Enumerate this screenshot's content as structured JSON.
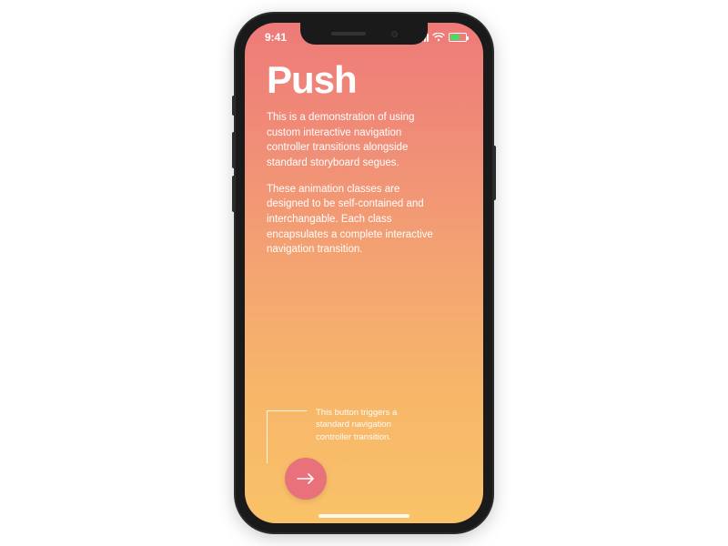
{
  "status": {
    "time": "9:41",
    "battery_pct": 55
  },
  "page": {
    "title": "Push",
    "paragraph1": "This is a demonstration of using custom interactive navigation controller transitions alongside standard storyboard segues.",
    "paragraph2": "These animation classes are designed to be self-contained and interchangable. Each class encapsulates a complete interactive navigation transition."
  },
  "callout": {
    "text": "This button triggers a standard navigation controller transition."
  },
  "colors": {
    "gradient_top": "#ee7a78",
    "gradient_bottom": "#f9c268",
    "button": "#e9717c"
  }
}
